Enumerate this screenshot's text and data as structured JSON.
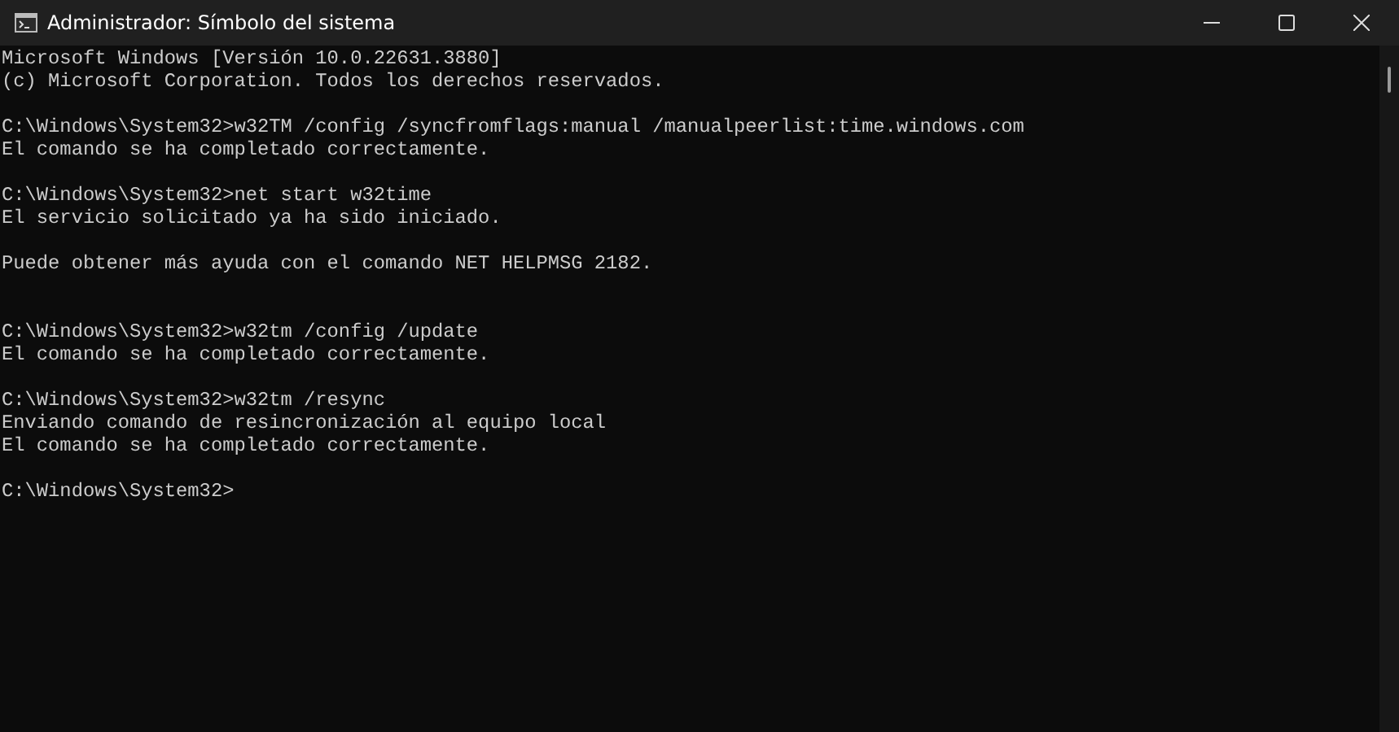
{
  "window": {
    "title": "Administrador: Símbolo del sistema"
  },
  "console": {
    "lines": [
      {
        "kind": "output",
        "text": "Microsoft Windows [Versión 10.0.22631.3880]"
      },
      {
        "kind": "output",
        "text": "(c) Microsoft Corporation. Todos los derechos reservados."
      },
      {
        "kind": "blank"
      },
      {
        "kind": "output",
        "text": "C:\\Windows\\System32>w32TM /config /syncfromflags:manual /manualpeerlist:time.windows.com"
      },
      {
        "kind": "output",
        "text": "El comando se ha completado correctamente."
      },
      {
        "kind": "blank"
      },
      {
        "kind": "output",
        "text": "C:\\Windows\\System32>net start w32time"
      },
      {
        "kind": "output",
        "text": "El servicio solicitado ya ha sido iniciado."
      },
      {
        "kind": "blank"
      },
      {
        "kind": "output",
        "text": "Puede obtener más ayuda con el comando NET HELPMSG 2182."
      },
      {
        "kind": "blank"
      },
      {
        "kind": "blank"
      },
      {
        "kind": "output",
        "text": "C:\\Windows\\System32>w32tm /config /update"
      },
      {
        "kind": "output",
        "text": "El comando se ha completado correctamente."
      },
      {
        "kind": "blank"
      },
      {
        "kind": "output",
        "text": "C:\\Windows\\System32>w32tm /resync"
      },
      {
        "kind": "output",
        "text": "Enviando comando de resincronización al equipo local"
      },
      {
        "kind": "output",
        "text": "El comando se ha completado correctamente."
      },
      {
        "kind": "blank"
      },
      {
        "kind": "output",
        "text": "C:\\Windows\\System32>"
      }
    ]
  }
}
